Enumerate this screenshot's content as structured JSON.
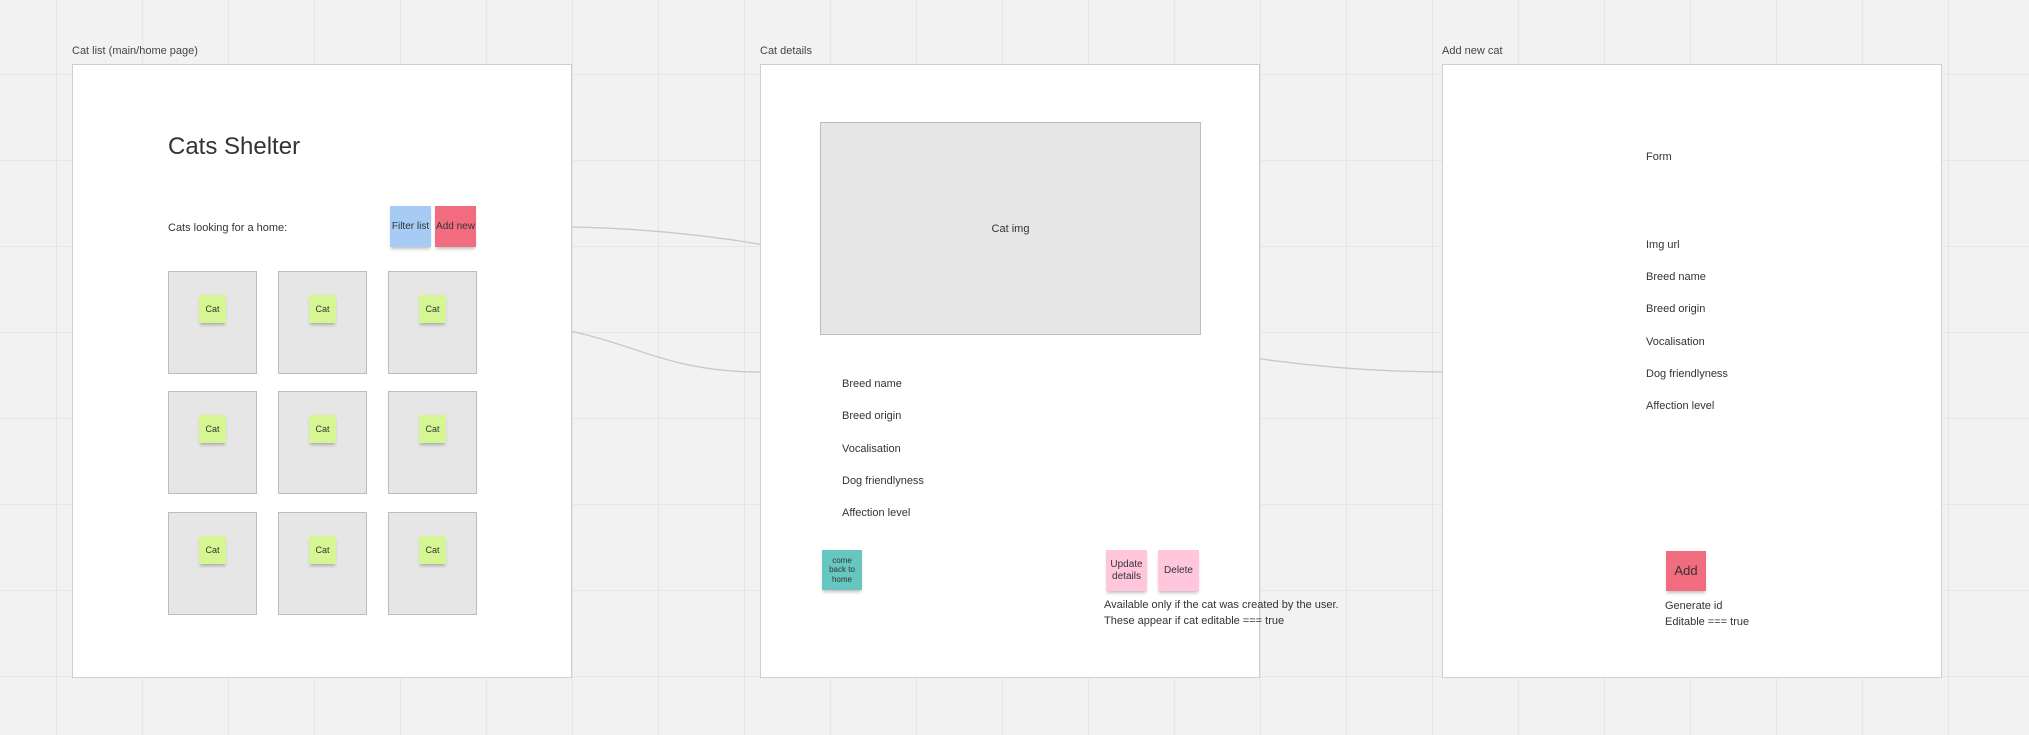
{
  "frames": {
    "list": {
      "label": "Cat list (main/home page)",
      "title": "Cats Shelter",
      "subtitle": "Cats looking for a home:",
      "filter_label": "Filter list",
      "add_label": "Add new",
      "cat_label": "Cat"
    },
    "details": {
      "label": "Cat details",
      "image_label": "Cat img",
      "fields": [
        "Breed name",
        "Breed origin",
        "Vocalisation",
        "Dog friendlyness",
        "Affection level"
      ],
      "home_label": "come back to home",
      "update_label": "Update details",
      "delete_label": "Delete",
      "note_line1": "Available only if the cat was created by the user.",
      "note_line2": "These appear if cat editable === true"
    },
    "add": {
      "label": "Add new cat",
      "form_label": "Form",
      "fields": [
        "Img url",
        "Breed name",
        "Breed origin",
        "Vocalisation",
        "Dog friendlyness",
        "Affection level"
      ],
      "add_label": "Add",
      "note_line1": "Generate id",
      "note_line2": "Editable === true"
    }
  },
  "colors": {
    "filter_sticky": "#a6ccf5",
    "add_sticky": "#f16c7f",
    "cat_sticky": "#d5f692",
    "home_sticky": "#67c6c0",
    "update_sticky": "#ffc6dc",
    "delete_sticky": "#ffc6dc"
  }
}
